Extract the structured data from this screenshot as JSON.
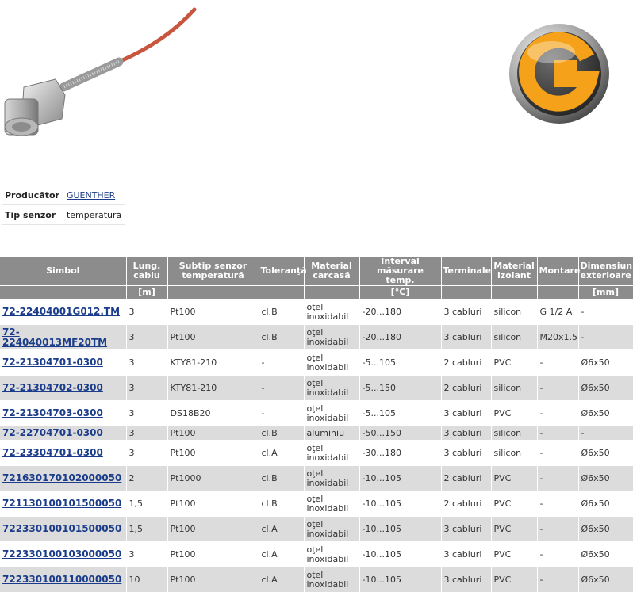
{
  "attributes": [
    {
      "key": "Producător",
      "value": "GUENTHER",
      "link": true
    },
    {
      "key": "Tip senzor",
      "value": "temperatură",
      "link": false
    }
  ],
  "table": {
    "headers": [
      {
        "label": "Simbol",
        "unit": ""
      },
      {
        "label": "Lung. cablu",
        "unit": "[m]"
      },
      {
        "label": "Subtip senzor temperatură",
        "unit": ""
      },
      {
        "label": "Toleranţă",
        "unit": ""
      },
      {
        "label": "Material carcasă",
        "unit": ""
      },
      {
        "label": "Interval măsurare temp.",
        "unit": "[°C]"
      },
      {
        "label": "Terminale",
        "unit": ""
      },
      {
        "label": "Material izolant",
        "unit": ""
      },
      {
        "label": "Montare",
        "unit": ""
      },
      {
        "label": "Dimensiuni exterioare",
        "unit": "[mm]"
      }
    ],
    "rows": [
      [
        "72-22404001G012.TM",
        "3",
        "Pt100",
        "cl.B",
        "oţel inoxidabil",
        "-20...180",
        "3 cabluri",
        "silicon",
        "G 1/2 A",
        "-"
      ],
      [
        "72-224040013MF20TM",
        "3",
        "Pt100",
        "cl.B",
        "oţel inoxidabil",
        "-20...180",
        "3 cabluri",
        "silicon",
        "M20x1.5",
        "-"
      ],
      [
        "72-21304701-0300",
        "3",
        "KTY81-210",
        "-",
        "oţel inoxidabil",
        "-5...105",
        "2 cabluri",
        "PVC",
        "-",
        "Ø6x50"
      ],
      [
        "72-21304702-0300",
        "3",
        "KTY81-210",
        "-",
        "oţel inoxidabil",
        "-5...150",
        "2 cabluri",
        "silicon",
        "-",
        "Ø6x50"
      ],
      [
        "72-21304703-0300",
        "3",
        "DS18B20",
        "-",
        "oţel inoxidabil",
        "-5...105",
        "3 cabluri",
        "PVC",
        "-",
        "Ø6x50"
      ],
      [
        "72-22704701-0300",
        "3",
        "Pt100",
        "cl.B",
        "aluminiu",
        "-50...150",
        "3 cabluri",
        "silicon",
        "-",
        "-"
      ],
      [
        "72-23304701-0300",
        "3",
        "Pt100",
        "cl.A",
        "oţel inoxidabil",
        "-30...180",
        "3 cabluri",
        "silicon",
        "-",
        "Ø6x50"
      ],
      [
        "721630170102000050",
        "2",
        "Pt1000",
        "cl.B",
        "oţel inoxidabil",
        "-10...105",
        "2 cabluri",
        "PVC",
        "-",
        "Ø6x50"
      ],
      [
        "721130100101500050",
        "1,5",
        "Pt100",
        "cl.B",
        "oţel inoxidabil",
        "-10...105",
        "2 cabluri",
        "PVC",
        "-",
        "Ø6x50"
      ],
      [
        "722330100101500050",
        "1,5",
        "Pt100",
        "cl.A",
        "oţel inoxidabil",
        "-10...105",
        "3 cabluri",
        "PVC",
        "-",
        "Ø6x50"
      ],
      [
        "722330100103000050",
        "3",
        "Pt100",
        "cl.A",
        "oţel inoxidabil",
        "-10...105",
        "3 cabluri",
        "PVC",
        "-",
        "Ø6x50"
      ],
      [
        "722330100110000050",
        "10",
        "Pt100",
        "cl.A",
        "oţel inoxidabil",
        "-10...105",
        "3 cabluri",
        "PVC",
        "-",
        "Ø6x50"
      ]
    ]
  },
  "colors": {
    "header_bg": "#8c8c8c",
    "alt_row": "#dcdcdc",
    "link": "#1a3c8a",
    "cable": "#c8563e",
    "logo_orange": "#f5a21a"
  },
  "icons": {
    "product": "temperature-sensor-photo",
    "brand": "guenther-logo"
  }
}
